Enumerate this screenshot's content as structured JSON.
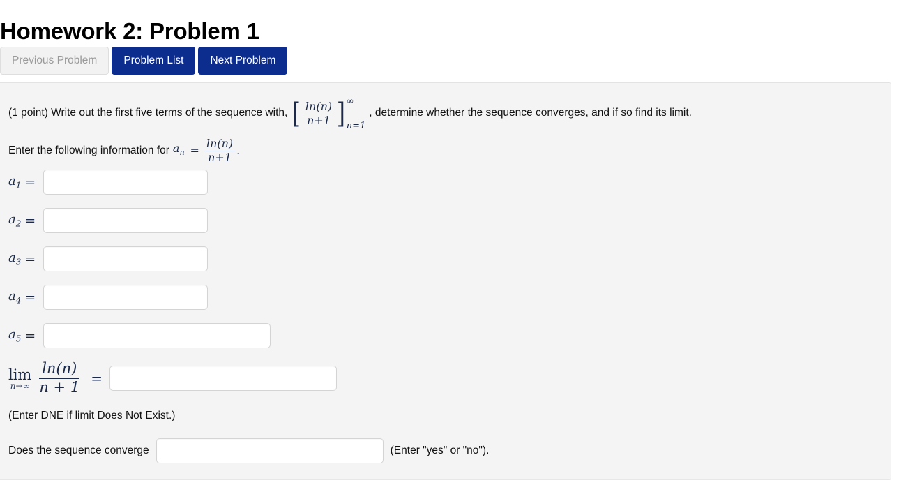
{
  "header": {
    "title": "Homework 2: Problem 1",
    "buttons": [
      {
        "label": "Previous Problem",
        "state": "disabled"
      },
      {
        "label": "Problem List",
        "state": "primary"
      },
      {
        "label": "Next Problem",
        "state": "primary"
      }
    ]
  },
  "problem": {
    "points_prefix": "(1 point) Write out the first five terms of the sequence with,",
    "statement_suffix": ", determine whether the sequence converges, and if so find its limit.",
    "sequence_expr": {
      "numerator": "ln(n)",
      "denominator": "n+1",
      "superscript": "∞",
      "subscript": "n=1",
      "bracket_open": "[",
      "bracket_close": "]"
    },
    "enter_info_prefix": "Enter the following information for",
    "an_symbol": "a",
    "an_subscript": "n",
    "equals": "=",
    "an_expr": {
      "numerator": "ln(n)",
      "denominator": "n+1"
    },
    "period": "."
  },
  "terms": [
    {
      "label_base": "a",
      "label_index": "1",
      "equals": "=",
      "value": "",
      "placeholder": "",
      "width": "small"
    },
    {
      "label_base": "a",
      "label_index": "2",
      "equals": "=",
      "value": "",
      "placeholder": "",
      "width": "small"
    },
    {
      "label_base": "a",
      "label_index": "3",
      "equals": "=",
      "value": "",
      "placeholder": "",
      "width": "small"
    },
    {
      "label_base": "a",
      "label_index": "4",
      "equals": "=",
      "value": "",
      "placeholder": "",
      "width": "small"
    },
    {
      "label_base": "a",
      "label_index": "5",
      "equals": "=",
      "value": "",
      "placeholder": "",
      "width": "large"
    }
  ],
  "limit": {
    "operator": "lim",
    "operator_sub": "n→∞",
    "numerator": "ln(n)",
    "denominator": "n + 1",
    "equals": "=",
    "value": "",
    "placeholder": "",
    "note": "(Enter DNE if limit Does Not Exist.)"
  },
  "converge": {
    "question": "Does the sequence converge",
    "value": "",
    "placeholder": "",
    "hint": "(Enter \"yes\" or \"no\")."
  },
  "colors": {
    "primary_button": "#0c2c8e",
    "disabled_button_bg": "#f2f2f2",
    "disabled_button_text": "#9a9a9a",
    "panel_bg": "#f4f4f4",
    "math_text": "#1b2a4a",
    "input_border": "#d4d4d4"
  }
}
